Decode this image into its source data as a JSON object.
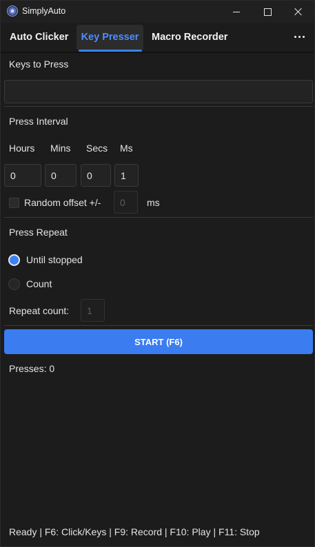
{
  "window": {
    "title": "SimplyAuto",
    "icon": "app-logo-icon",
    "controls": [
      "minimize-icon",
      "maximize-icon",
      "close-icon"
    ]
  },
  "tabs": [
    {
      "label": "Auto Clicker",
      "active": false
    },
    {
      "label": "Key Presser",
      "active": true
    },
    {
      "label": "Macro Recorder",
      "active": false
    }
  ],
  "more_icon": "more-horizontal-icon",
  "keys": {
    "label": "Keys to Press",
    "value": ""
  },
  "interval": {
    "label": "Press Interval",
    "units": [
      "Hours",
      "Mins",
      "Secs",
      "Ms"
    ],
    "values": [
      "0",
      "0",
      "0",
      "1"
    ],
    "random_offset_label": "Random offset +/-",
    "random_offset_value": "0",
    "random_offset_unit": "ms",
    "random_offset_checked": false
  },
  "repeat": {
    "label": "Press Repeat",
    "options": [
      {
        "label": "Until stopped",
        "selected": true
      },
      {
        "label": "Count",
        "selected": false
      }
    ],
    "count_label": "Repeat count:",
    "count_value": "1"
  },
  "start_button": "START (F6)",
  "presses_text": "Presses: 0",
  "status_bar": "Ready | F6: Click/Keys | F9: Record | F10: Play | F11: Stop",
  "colors": {
    "accent": "#3b82f6",
    "background": "#1c1c1c",
    "titlebar": "#202020"
  }
}
